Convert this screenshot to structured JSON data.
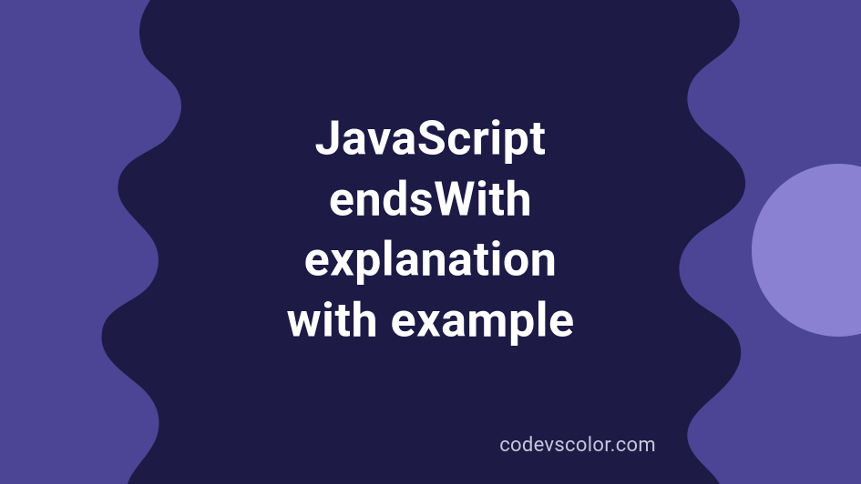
{
  "title": "JavaScript\nendsWith\nexplanation\nwith example",
  "footer": "codevscolor.com",
  "colors": {
    "background": "#4c4595",
    "blob": "#1d1a46",
    "text_primary": "#ffffff",
    "text_secondary": "#c8c6db",
    "accent_circle": "#a096e8"
  }
}
